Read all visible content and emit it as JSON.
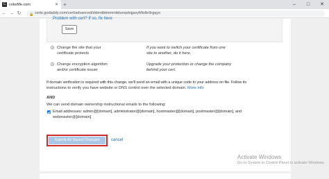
{
  "browser": {
    "tab_title": "colorlife.com",
    "tab_favicon": "C",
    "new_tab": "+",
    "url": "certs.godaddy.com/cert/advanced/zkbmtbtmmmitdunqvkqjaxyMtxlle9rgqyo"
  },
  "top_section": {
    "cut_text": "Problem with cert? If so, fix here",
    "save_label": "Save"
  },
  "options": [
    {
      "label_line1": "Change the site that your",
      "label_line2": "certificate protects",
      "desc_line1": "If you want to switch your certificate from one",
      "desc_line2": "site to another, do it here."
    },
    {
      "label_line1": "Change encryption algorithm",
      "label_line2": "and/or certificate issuer",
      "desc_line1": "Upgrade your protection or change the company",
      "desc_line2": "behind your cert."
    }
  ],
  "verification": {
    "para1_line1": "If domain verification is required with this change, we'll send an email with a unique code to your address on file. Follow its",
    "para1_line2": "instructions to verify you have website or DNS control over the selected domain.",
    "more_info": "More info",
    "and_label": "AND",
    "para2": "We can send domain ownership instructional emails to the following:",
    "emails_line1": "Email addresses: admin@[domain], administrator@[domain], hostmaster@[domain], postmaster@[domain], and",
    "emails_line2": "webmaster@[domain]"
  },
  "actions": {
    "submit_label": "Submit All Saved Changes",
    "cancel_label": "cancel"
  },
  "watermark": {
    "line1": "Activate Windows",
    "line2": "Go to System in Control Panel to activate Windows."
  }
}
